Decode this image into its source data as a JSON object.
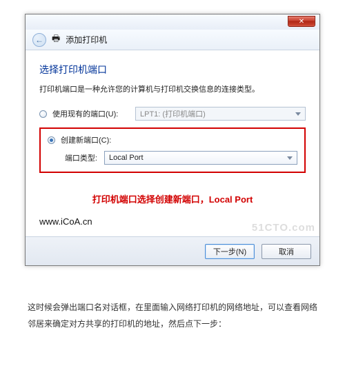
{
  "wizard": {
    "window_title": "添加打印机",
    "heading": "选择打印机端口",
    "description": "打印机端口是一种允许您的计算机与打印机交换信息的连接类型。",
    "option_existing": {
      "label": "使用现有的端口(U):",
      "value": "LPT1: (打印机端口)"
    },
    "option_new": {
      "label": "创建新端口(C):",
      "type_label": "端口类型:",
      "type_value": "Local Port"
    },
    "annotation": "打印机端口选择创建新端口，Local Port",
    "site": "www.iCoA.cn",
    "ghost_watermark": "51CTO.com",
    "buttons": {
      "next": "下一步(N)",
      "cancel": "取消"
    },
    "close_glyph": "✕"
  },
  "caption": "这时候会弹出端口名对话框，在里面输入网络打印机的网络地址，可以查看网络邻居来确定对方共享的打印机的地址，然后点下一步："
}
